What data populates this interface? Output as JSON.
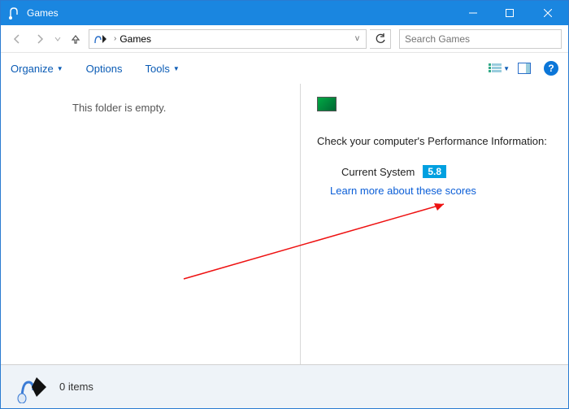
{
  "titlebar": {
    "title": "Games"
  },
  "nav": {
    "breadcrumb": "Games",
    "search_placeholder": "Search Games"
  },
  "toolbar": {
    "organize": "Organize",
    "options": "Options",
    "tools": "Tools"
  },
  "content": {
    "empty_message": "This folder is empty.",
    "perf_text": "Check your computer's Performance Information:",
    "score_label": "Current System",
    "score_value": "5.8",
    "learn_more": "Learn more about these scores"
  },
  "statusbar": {
    "item_count": "0 items"
  }
}
